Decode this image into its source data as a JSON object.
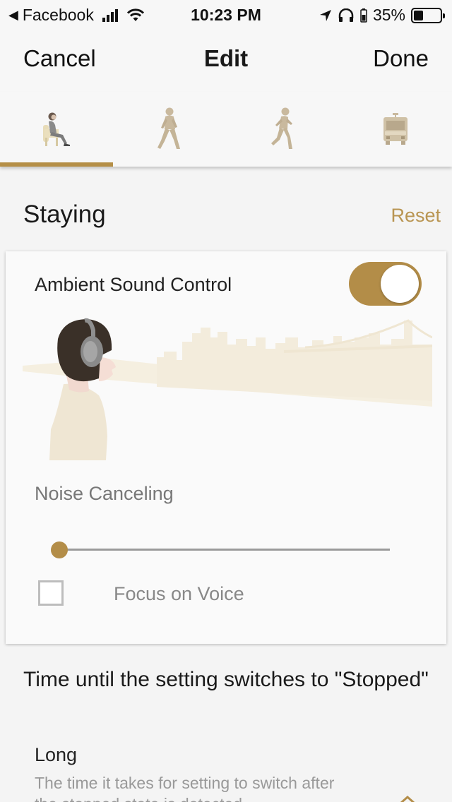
{
  "status_bar": {
    "back_app": "Facebook",
    "time": "10:23 PM",
    "battery_percent": "35%",
    "battery_level": 0.35
  },
  "nav": {
    "cancel": "Cancel",
    "title": "Edit",
    "done": "Done"
  },
  "tabs": [
    {
      "name": "staying",
      "icon": "sitting-person-icon",
      "active": true
    },
    {
      "name": "walking",
      "icon": "walking-person-icon",
      "active": false
    },
    {
      "name": "running",
      "icon": "running-person-icon",
      "active": false
    },
    {
      "name": "transport",
      "icon": "train-icon",
      "active": false
    }
  ],
  "section": {
    "title": "Staying",
    "reset": "Reset"
  },
  "ambient": {
    "label": "Ambient Sound Control",
    "enabled": true,
    "mode": "Noise Canceling",
    "slider_value": 0,
    "focus_on_voice_label": "Focus on Voice",
    "focus_on_voice_checked": false
  },
  "timer": {
    "title": "Time until the setting switches to \"Stopped\"",
    "option": "Long",
    "description": "The time it takes for setting to switch after the stopped state is detected"
  },
  "colors": {
    "accent": "#b38d48",
    "reset": "#b99552"
  }
}
